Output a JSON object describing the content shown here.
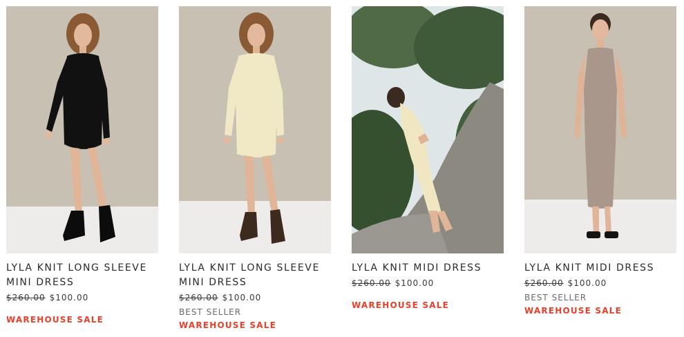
{
  "products": [
    {
      "title": "LYLA KNIT LONG SLEEVE MINI DRESS",
      "old_price": "$260.00",
      "price": "$100.00",
      "best_seller": "",
      "sale_badge": "WAREHOUSE SALE",
      "dress_color": "#111111",
      "image": "model-black-mini-dress"
    },
    {
      "title": "LYLA KNIT LONG SLEEVE MINI DRESS",
      "old_price": "$260.00",
      "price": "$100.00",
      "best_seller": "BEST SELLER",
      "sale_badge": "WAREHOUSE SALE",
      "dress_color": "#f1e9c6",
      "image": "model-cream-mini-dress"
    },
    {
      "title": "LYLA KNIT MIDI DRESS",
      "old_price": "$260.00",
      "price": "$100.00",
      "best_seller": "",
      "sale_badge": "WAREHOUSE SALE",
      "dress_color": "#f0e6c2",
      "image": "model-cream-midi-dress-outdoor"
    },
    {
      "title": "LYLA KNIT MIDI DRESS",
      "old_price": "$260.00",
      "price": "$100.00",
      "best_seller": "BEST SELLER",
      "sale_badge": "WAREHOUSE SALE",
      "dress_color": "#a8978a",
      "image": "model-taupe-midi-dress"
    }
  ],
  "colors": {
    "sale": "#e8402b",
    "studio_wall": "#c9c0b4",
    "studio_floor": "#eeeceb"
  }
}
